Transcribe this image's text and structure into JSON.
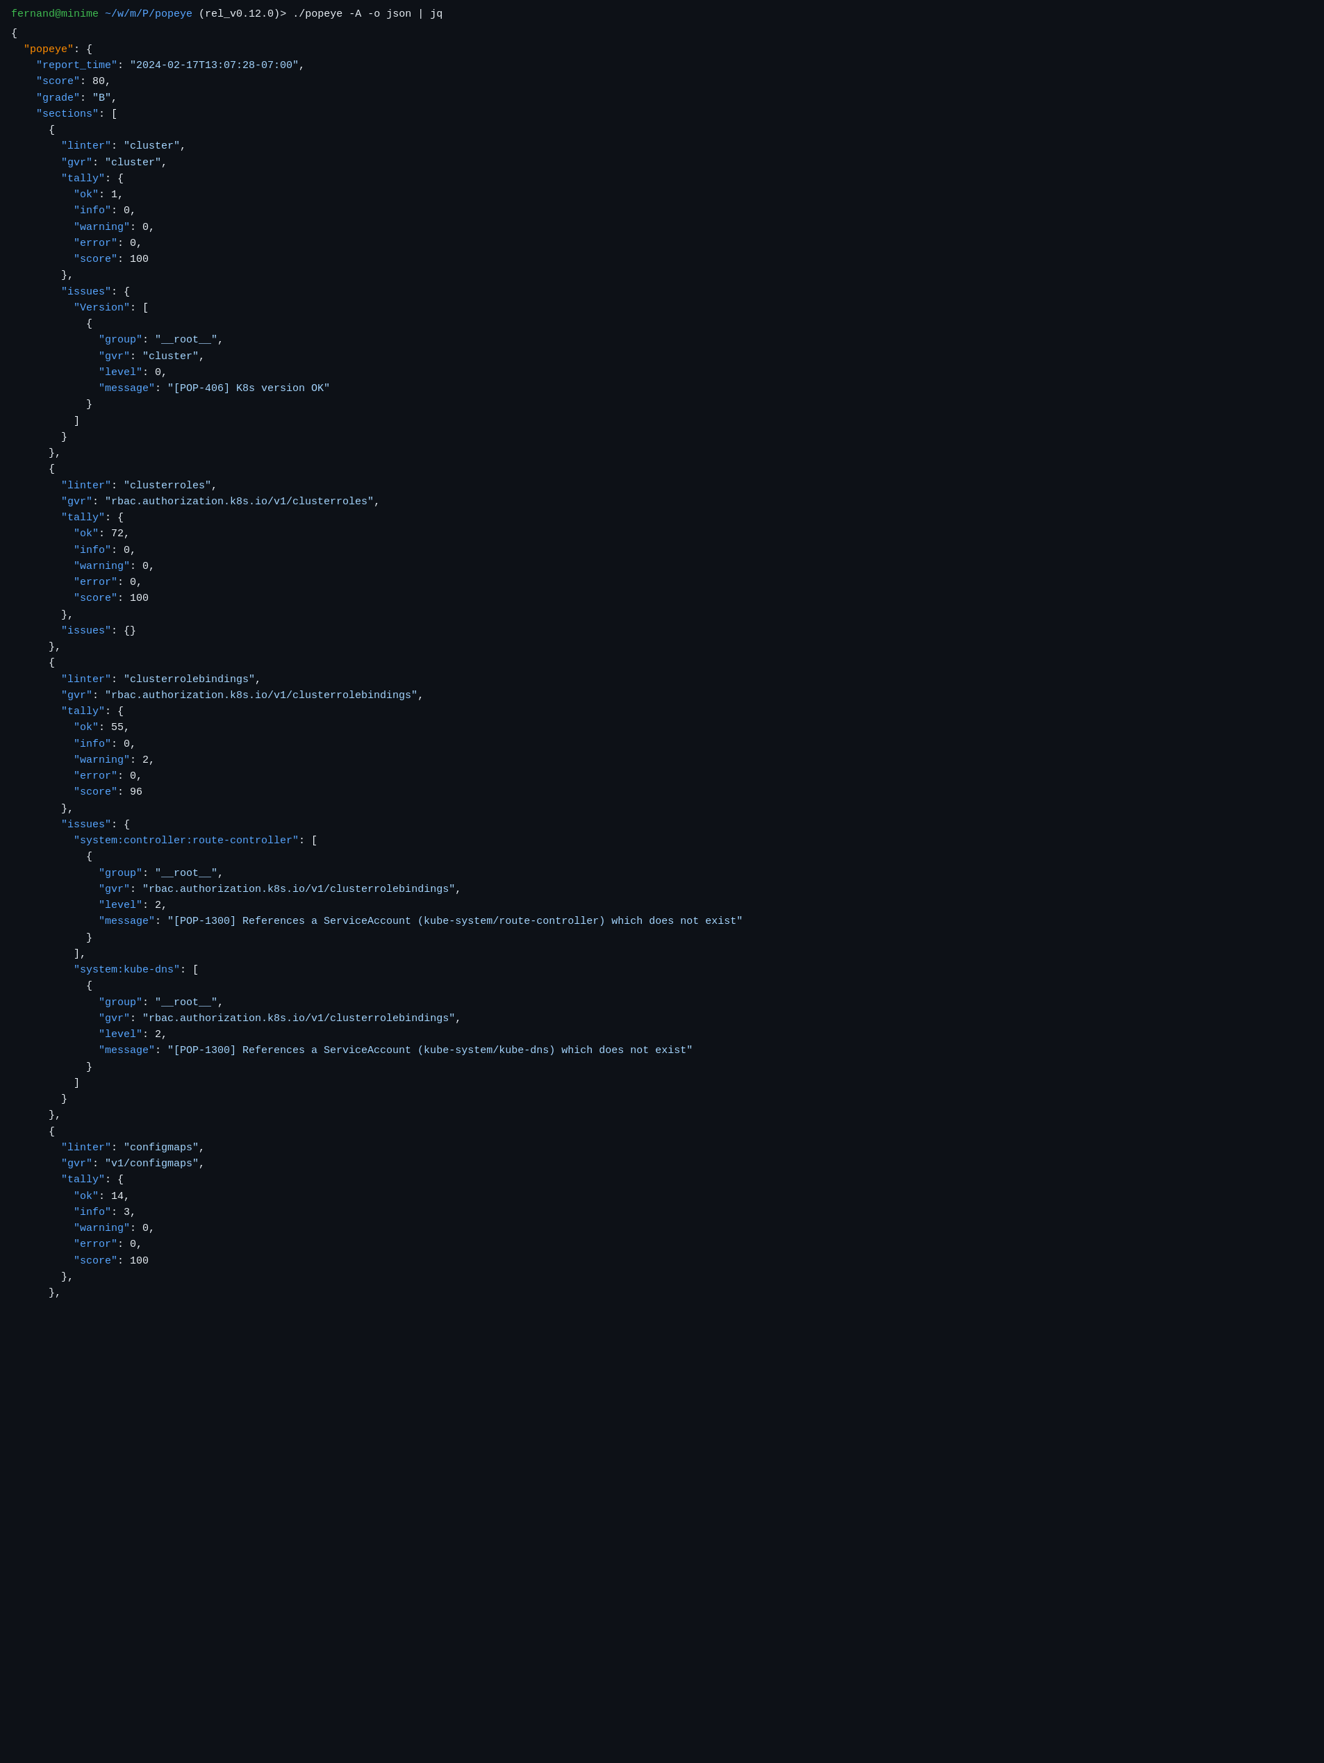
{
  "terminal": {
    "prompt": "fernand@minime ~/w/m/P/popeye (rel_v0.12.0)>",
    "command": "./popeye -A -o json | jq",
    "output": {
      "popeye_key": "popeye",
      "report_time_key": "report_time",
      "report_time_val": "2024-02-17T13:07:28-07:00",
      "score_key": "score",
      "score_val": "80",
      "grade_key": "grade",
      "grade_val": "B",
      "sections_key": "sections"
    }
  }
}
